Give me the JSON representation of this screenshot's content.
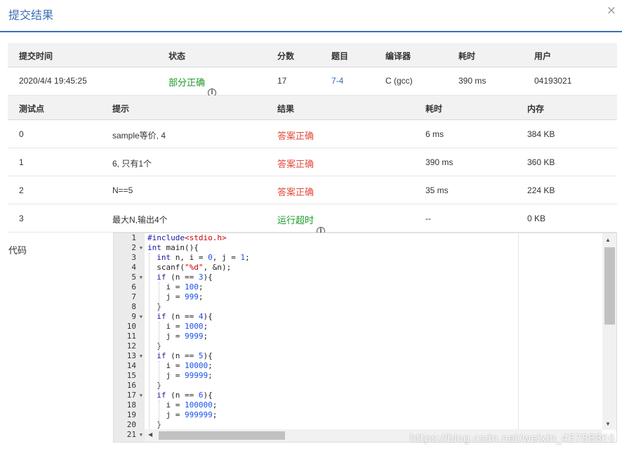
{
  "dialog": {
    "title": "提交结果",
    "close": "×"
  },
  "summary": {
    "headers": [
      "提交时间",
      "状态",
      "分数",
      "题目",
      "编译器",
      "耗时",
      "用户"
    ],
    "values": {
      "time": "2020/4/4 19:45:25",
      "status": "部分正确",
      "score": "17",
      "problem": "7-4",
      "compiler": "C (gcc)",
      "duration": "390 ms",
      "user": "04193021"
    }
  },
  "cases": {
    "headers": [
      "测试点",
      "提示",
      "结果",
      "耗时",
      "内存"
    ],
    "rows": [
      {
        "id": "0",
        "hint": "sample等价, 4",
        "result": "答案正确",
        "time": "6 ms",
        "memory": "384 KB"
      },
      {
        "id": "1",
        "hint": "6, 只有1个",
        "result": "答案正确",
        "time": "390 ms",
        "memory": "360 KB"
      },
      {
        "id": "2",
        "hint": "N==5",
        "result": "答案正确",
        "time": "35 ms",
        "memory": "224 KB"
      },
      {
        "id": "3",
        "hint": "最大N,输出4个",
        "result": "运行超时",
        "time": "--",
        "memory": "0 KB"
      }
    ]
  },
  "code": {
    "label": "代码",
    "line_numbers": [
      "1",
      "2",
      "3",
      "4",
      "5",
      "6",
      "7",
      "8",
      "9",
      "10",
      "11",
      "12",
      "13",
      "14",
      "15",
      "16",
      "17",
      "18",
      "19",
      "20",
      "21"
    ],
    "lines": [
      "#include<stdio.h>",
      "int main(){",
      "  int n, i = 0, j = 1;",
      "  scanf(\"%d\", &n);",
      "  if (n == 3){",
      "    i = 100;",
      "    j = 999;",
      "  }",
      "  if (n == 4){",
      "    i = 1000;",
      "    j = 9999;",
      "  }",
      "  if (n == 5){",
      "    i = 10000;",
      "    j = 99999;",
      "  }",
      "  if (n == 6){",
      "    i = 100000;",
      "    j = 999999;",
      "  }",
      ""
    ]
  },
  "watermark": "https://blog.csdn.net/weixin_45788866",
  "colors": {
    "accent": "#3d6fb6",
    "success": "#1c9a26",
    "error": "#e24a3b"
  }
}
